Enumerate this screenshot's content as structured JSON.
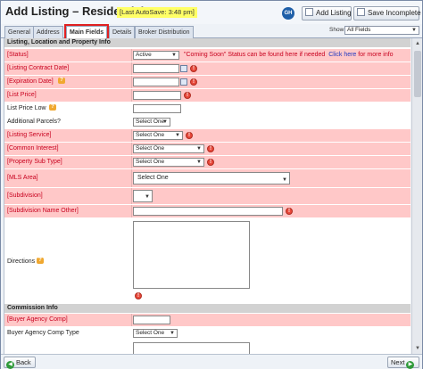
{
  "header": {
    "title": "Add Listing – Residential",
    "autosave": "[Last AutoSave: 3:48 pm]",
    "badge": "GH",
    "add_listing": "Add Listing",
    "save_incomplete": "Save Incomplete"
  },
  "tabs": [
    {
      "label": "General"
    },
    {
      "label": "Address"
    },
    {
      "label": "Main Fields",
      "active": true
    },
    {
      "label": "Details"
    },
    {
      "label": "Broker Distribution"
    }
  ],
  "show": {
    "label": "Show",
    "value": "All Fields"
  },
  "sections": {
    "listing": "Listing, Location and Property Info",
    "commission": "Commission Info"
  },
  "fields": {
    "status": {
      "label": "[Status]",
      "value": "Active",
      "note": "\"Coming Soon\" Status can be found here if needed",
      "link": "Click here",
      "link_suffix": "for more info"
    },
    "contract_date": {
      "label": "[Listing Contract Date]"
    },
    "expiration_date": {
      "label": "[Expiration Date]"
    },
    "list_price": {
      "label": "[List Price]"
    },
    "list_price_low": {
      "label": "List Price Low"
    },
    "additional_parcels": {
      "label": "Additional Parcels?",
      "value": "Select One"
    },
    "listing_service": {
      "label": "[Listing Service]",
      "value": "Select One"
    },
    "common_interest": {
      "label": "[Common Interest]",
      "value": "Select One"
    },
    "property_sub_type": {
      "label": "[Property Sub Type]",
      "value": "Select One"
    },
    "mls_area": {
      "label": "[MLS Area]",
      "value": "Select One"
    },
    "subdivision": {
      "label": "[Subdivision]"
    },
    "subdivision_other": {
      "label": "[Subdivision Name Other]"
    },
    "directions": {
      "label": "Directions"
    },
    "buyer_agency_comp": {
      "label": "[Buyer Agency Comp]"
    },
    "buyer_agency_comp_type": {
      "label": "Buyer Agency Comp Type",
      "value": "Select One"
    }
  },
  "footer": {
    "back": "Back",
    "next": "Next"
  },
  "colors": {
    "required_row": "#ffc8c8",
    "required_text": "#c8001e",
    "section_header": "#d2d2d2",
    "link": "#2038c0"
  }
}
